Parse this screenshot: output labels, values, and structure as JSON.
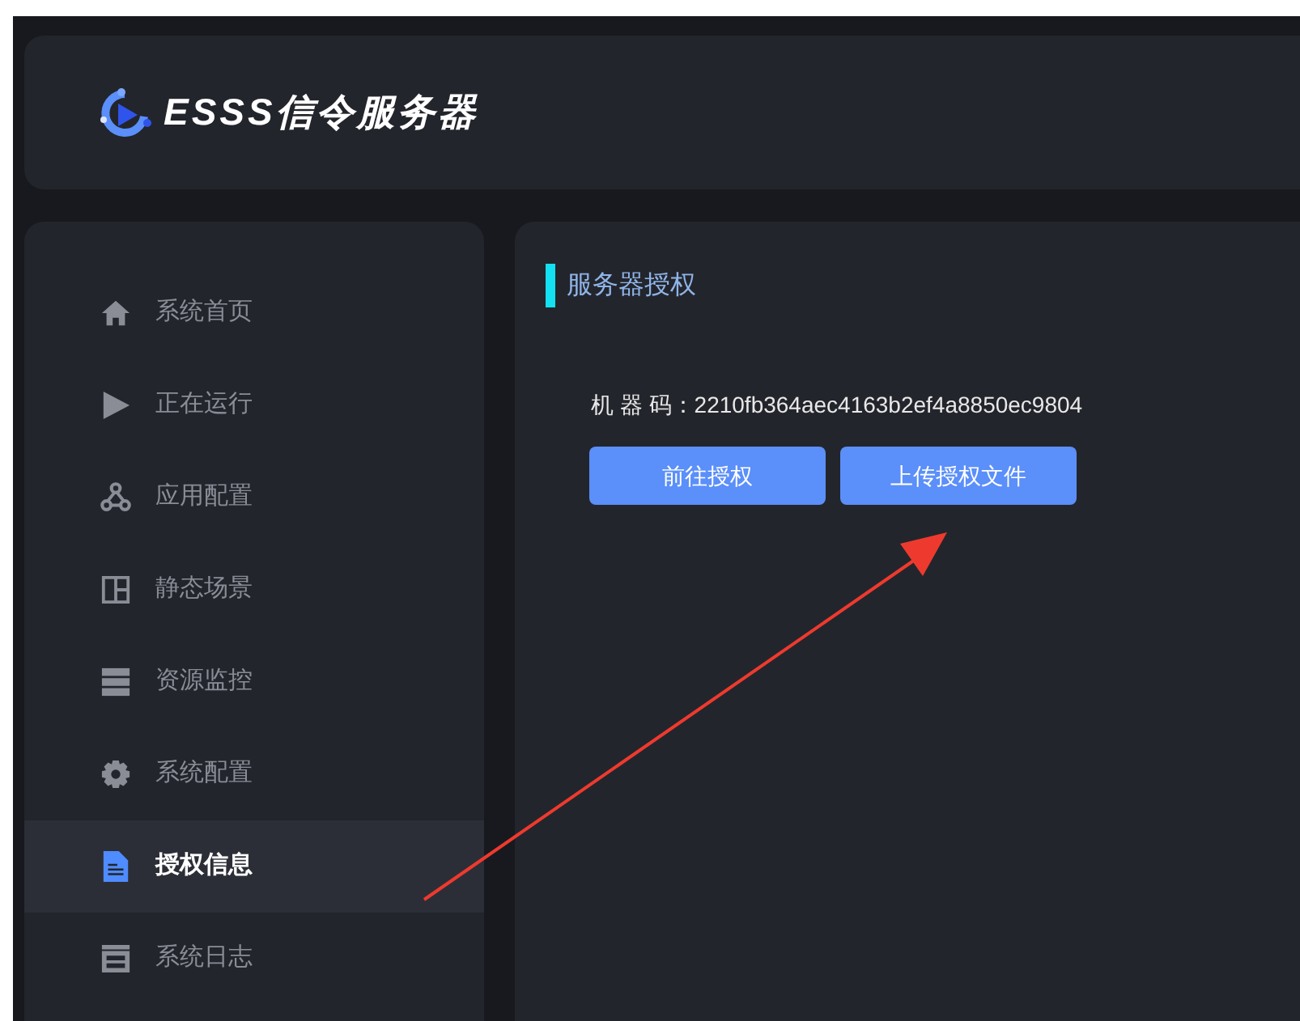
{
  "header": {
    "logo_text": "ESSS信令服务器"
  },
  "sidebar": {
    "items": [
      {
        "label": "系统首页",
        "selected": false
      },
      {
        "label": "正在运行",
        "selected": false
      },
      {
        "label": "应用配置",
        "selected": false
      },
      {
        "label": "静态场景",
        "selected": false
      },
      {
        "label": "资源监控",
        "selected": false
      },
      {
        "label": "系统配置",
        "selected": false
      },
      {
        "label": "授权信息",
        "selected": true
      },
      {
        "label": "系统日志",
        "selected": false
      }
    ]
  },
  "main": {
    "section_title": "服务器授权",
    "machine_code": "机 器 码：2210fb364aec4163b2ef4a8850ec9804",
    "buttons": [
      "前往授权",
      "上传授权文件"
    ]
  }
}
